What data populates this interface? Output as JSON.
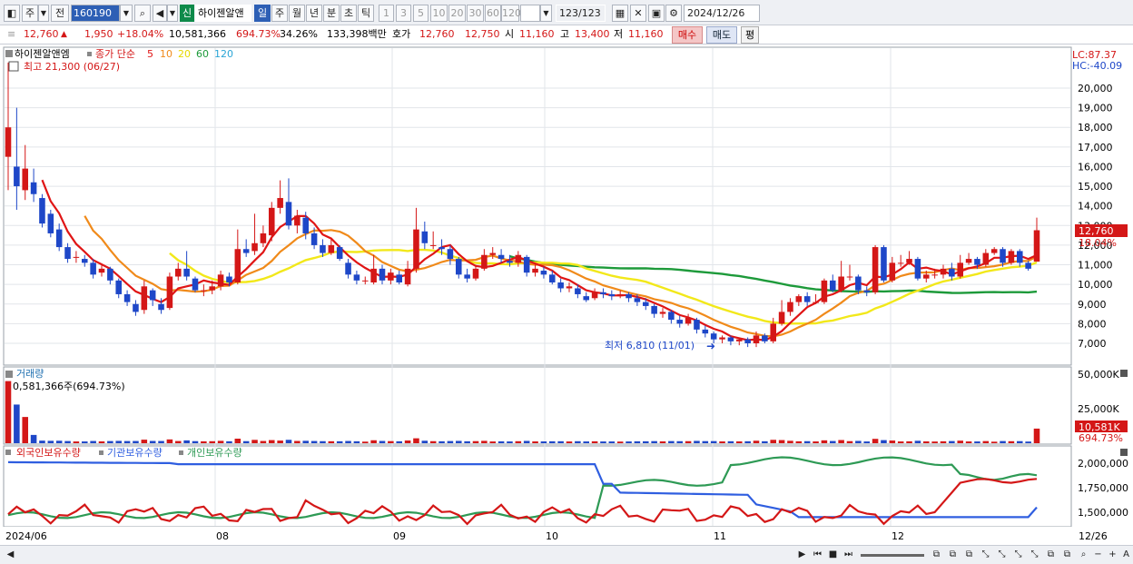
{
  "toolbar": {
    "market": "주",
    "scope": "전",
    "code": "160190",
    "flag": "신",
    "name": "하이젠알앤",
    "periods": [
      "일",
      "주",
      "월",
      "년",
      "분",
      "초",
      "틱"
    ],
    "selected_period": "일",
    "intervals": [
      "1",
      "3",
      "5",
      "10",
      "20",
      "30",
      "60",
      "120"
    ],
    "count": "123",
    "count_total": "/123",
    "date": "2024/12/26"
  },
  "quote": {
    "price": "12,760",
    "change": "1,950",
    "change_pct": "+18.04%",
    "volume": "10,581,366",
    "vol_ratio": "694.73%",
    "turnover": "34.26%",
    "amount": "133,398백만",
    "hoga_label": "호가",
    "ask": "12,760",
    "bid": "12,750",
    "open_label": "시",
    "open": "11,160",
    "high_label": "고",
    "high": "13,400",
    "low_label": "저",
    "low": "11,160",
    "buy": "매수",
    "sell": "매도",
    "avg": "평"
  },
  "price_panel": {
    "legend_name": "하이젠알앤엠",
    "legend_close": "종가 단순",
    "ma_periods": [
      "5",
      "10",
      "20",
      "60",
      "120"
    ],
    "high_note": "최고 21,300 (06/27)",
    "low_note": "최저 6,810 (11/01)",
    "lc": "LC:87.37",
    "hc": "HC:-40.09",
    "current_price": "12,760",
    "current_pct": "18.04%",
    "y_ticks": [
      "20,000",
      "19,000",
      "18,000",
      "17,000",
      "16,000",
      "15,000",
      "14,000",
      "13,000",
      "12,000",
      "11,000",
      "10,000",
      "9,000",
      "8,000",
      "7,000"
    ]
  },
  "volume_panel": {
    "title": "거래량",
    "info": "0,581,366주(694.73%)",
    "y_ticks": [
      "50,000K",
      "25,000K"
    ],
    "current_vol": "10,581K",
    "current_pct": "694.73%"
  },
  "holding_panel": {
    "legend": [
      "외국인보유수량",
      "기관보유수량",
      "개인보유수량"
    ],
    "y_ticks": [
      "2,000,000",
      "1,750,000",
      "1,500,000"
    ]
  },
  "x_labels": [
    "2024/06",
    "08",
    "09",
    "10",
    "11",
    "12"
  ],
  "x_end_label": "12/26",
  "colors": {
    "up": "#d41717",
    "down": "#1e47c8",
    "ma5": "#e01515",
    "ma10": "#f08a1a",
    "ma20": "#f2e81a",
    "ma60": "#1d9a3a",
    "ma120": "#2aa5d6",
    "foreign": "#d41717",
    "institution": "#2f5ee0",
    "individual": "#2e9a55"
  },
  "chart_data": {
    "type": "candlestick",
    "price_range": [
      6500,
      21300
    ],
    "candles": [
      {
        "o": 16500,
        "c": 18000,
        "h": 21300,
        "l": 14800
      },
      {
        "o": 16000,
        "c": 15000,
        "h": 19000,
        "l": 13800
      },
      {
        "o": 14800,
        "c": 15900,
        "h": 17100,
        "l": 14300
      },
      {
        "o": 15200,
        "c": 14600,
        "h": 15900,
        "l": 14200
      },
      {
        "o": 14400,
        "c": 13100,
        "h": 14600,
        "l": 12900
      },
      {
        "o": 13600,
        "c": 12600,
        "h": 13800,
        "l": 12400
      },
      {
        "o": 12800,
        "c": 11900,
        "h": 13100,
        "l": 11700
      },
      {
        "o": 11900,
        "c": 11300,
        "h": 12100,
        "l": 11100
      },
      {
        "o": 11400,
        "c": 11400,
        "h": 11700,
        "l": 11100
      },
      {
        "o": 11300,
        "c": 11100,
        "h": 11500,
        "l": 10900
      },
      {
        "o": 11100,
        "c": 10500,
        "h": 11300,
        "l": 10300
      },
      {
        "o": 10600,
        "c": 10800,
        "h": 11000,
        "l": 10400
      },
      {
        "o": 10800,
        "c": 10200,
        "h": 10900,
        "l": 10000
      },
      {
        "o": 10200,
        "c": 9500,
        "h": 10300,
        "l": 9300
      },
      {
        "o": 9500,
        "c": 9100,
        "h": 9700,
        "l": 8900
      },
      {
        "o": 9000,
        "c": 8600,
        "h": 9200,
        "l": 8400
      },
      {
        "o": 8700,
        "c": 9900,
        "h": 10200,
        "l": 8500
      },
      {
        "o": 9700,
        "c": 9200,
        "h": 9800,
        "l": 8900
      },
      {
        "o": 9000,
        "c": 8700,
        "h": 9300,
        "l": 8500
      },
      {
        "o": 8800,
        "c": 10400,
        "h": 10600,
        "l": 8700
      },
      {
        "o": 10400,
        "c": 10800,
        "h": 11100,
        "l": 10200
      },
      {
        "o": 10800,
        "c": 10400,
        "h": 11700,
        "l": 10200
      },
      {
        "o": 10300,
        "c": 9700,
        "h": 10400,
        "l": 9600
      },
      {
        "o": 9700,
        "c": 9700,
        "h": 10000,
        "l": 9400
      },
      {
        "o": 9700,
        "c": 9900,
        "h": 10200,
        "l": 9500
      },
      {
        "o": 9900,
        "c": 10500,
        "h": 10700,
        "l": 9700
      },
      {
        "o": 10400,
        "c": 10100,
        "h": 10600,
        "l": 9900
      },
      {
        "o": 10100,
        "c": 11800,
        "h": 12800,
        "l": 10000
      },
      {
        "o": 11800,
        "c": 11600,
        "h": 12300,
        "l": 11400
      },
      {
        "o": 11700,
        "c": 12100,
        "h": 13600,
        "l": 11500
      },
      {
        "o": 12100,
        "c": 12600,
        "h": 13000,
        "l": 11900
      },
      {
        "o": 12500,
        "c": 13900,
        "h": 14200,
        "l": 12200
      },
      {
        "o": 13900,
        "c": 14400,
        "h": 15300,
        "l": 13600
      },
      {
        "o": 14200,
        "c": 13000,
        "h": 15400,
        "l": 12800
      },
      {
        "o": 13000,
        "c": 13500,
        "h": 13800,
        "l": 12600
      },
      {
        "o": 13400,
        "c": 12600,
        "h": 13700,
        "l": 12300
      },
      {
        "o": 12600,
        "c": 12000,
        "h": 12900,
        "l": 11800
      },
      {
        "o": 12000,
        "c": 11600,
        "h": 12300,
        "l": 11400
      },
      {
        "o": 11600,
        "c": 12000,
        "h": 12300,
        "l": 11500
      },
      {
        "o": 11900,
        "c": 11300,
        "h": 12000,
        "l": 11200
      },
      {
        "o": 11100,
        "c": 10500,
        "h": 11300,
        "l": 10300
      },
      {
        "o": 10500,
        "c": 10200,
        "h": 10700,
        "l": 10000
      },
      {
        "o": 10200,
        "c": 10200,
        "h": 10400,
        "l": 10000
      },
      {
        "o": 10100,
        "c": 10800,
        "h": 11500,
        "l": 10000
      },
      {
        "o": 10800,
        "c": 10200,
        "h": 11000,
        "l": 10000
      },
      {
        "o": 10200,
        "c": 10600,
        "h": 10800,
        "l": 10000
      },
      {
        "o": 10500,
        "c": 10100,
        "h": 10700,
        "l": 10000
      },
      {
        "o": 10000,
        "c": 10800,
        "h": 11200,
        "l": 9900
      },
      {
        "o": 10800,
        "c": 12800,
        "h": 13900,
        "l": 10600
      },
      {
        "o": 12700,
        "c": 12100,
        "h": 13200,
        "l": 11800
      },
      {
        "o": 12000,
        "c": 12000,
        "h": 12700,
        "l": 11800
      },
      {
        "o": 11900,
        "c": 11800,
        "h": 12300,
        "l": 11500
      },
      {
        "o": 11800,
        "c": 11300,
        "h": 12000,
        "l": 11000
      },
      {
        "o": 11300,
        "c": 10500,
        "h": 11400,
        "l": 10300
      },
      {
        "o": 10500,
        "c": 10300,
        "h": 10800,
        "l": 10100
      },
      {
        "o": 10300,
        "c": 10800,
        "h": 11000,
        "l": 10200
      },
      {
        "o": 10800,
        "c": 11500,
        "h": 11800,
        "l": 10700
      },
      {
        "o": 11500,
        "c": 11600,
        "h": 11900,
        "l": 11300
      },
      {
        "o": 11500,
        "c": 11300,
        "h": 11800,
        "l": 11100
      },
      {
        "o": 11200,
        "c": 11100,
        "h": 11500,
        "l": 10900
      },
      {
        "o": 11100,
        "c": 11500,
        "h": 11700,
        "l": 10900
      },
      {
        "o": 11400,
        "c": 10600,
        "h": 11500,
        "l": 10400
      },
      {
        "o": 10600,
        "c": 10800,
        "h": 11000,
        "l": 10400
      },
      {
        "o": 10700,
        "c": 10500,
        "h": 10900,
        "l": 10300
      },
      {
        "o": 10500,
        "c": 10100,
        "h": 10700,
        "l": 10000
      },
      {
        "o": 10100,
        "c": 9800,
        "h": 10300,
        "l": 9600
      },
      {
        "o": 9800,
        "c": 9900,
        "h": 10100,
        "l": 9600
      },
      {
        "o": 9800,
        "c": 9500,
        "h": 10000,
        "l": 9300
      },
      {
        "o": 9400,
        "c": 9200,
        "h": 9600,
        "l": 9100
      },
      {
        "o": 9300,
        "c": 9600,
        "h": 9800,
        "l": 9200
      },
      {
        "o": 9600,
        "c": 9500,
        "h": 9800,
        "l": 9300
      },
      {
        "o": 9500,
        "c": 9400,
        "h": 9700,
        "l": 9200
      },
      {
        "o": 9400,
        "c": 9500,
        "h": 9700,
        "l": 9300
      },
      {
        "o": 9500,
        "c": 9300,
        "h": 9600,
        "l": 9100
      },
      {
        "o": 9300,
        "c": 9100,
        "h": 9500,
        "l": 8900
      },
      {
        "o": 9100,
        "c": 8900,
        "h": 9300,
        "l": 8700
      },
      {
        "o": 8900,
        "c": 8500,
        "h": 9000,
        "l": 8300
      },
      {
        "o": 8500,
        "c": 8600,
        "h": 8800,
        "l": 8300
      },
      {
        "o": 8600,
        "c": 8200,
        "h": 8700,
        "l": 8000
      },
      {
        "o": 8200,
        "c": 8000,
        "h": 8400,
        "l": 7800
      },
      {
        "o": 8000,
        "c": 8300,
        "h": 8500,
        "l": 7900
      },
      {
        "o": 8200,
        "c": 7700,
        "h": 8300,
        "l": 7500
      },
      {
        "o": 7700,
        "c": 7500,
        "h": 7900,
        "l": 7300
      },
      {
        "o": 7500,
        "c": 7200,
        "h": 7600,
        "l": 7000
      },
      {
        "o": 7200,
        "c": 7300,
        "h": 7400,
        "l": 7000
      },
      {
        "o": 7300,
        "c": 7100,
        "h": 7400,
        "l": 6900
      },
      {
        "o": 7100,
        "c": 7200,
        "h": 7300,
        "l": 6900
      },
      {
        "o": 7200,
        "c": 7000,
        "h": 7300,
        "l": 6810
      },
      {
        "o": 7000,
        "c": 7400,
        "h": 7600,
        "l": 6810
      },
      {
        "o": 7400,
        "c": 7100,
        "h": 7500,
        "l": 7000
      },
      {
        "o": 7100,
        "c": 8000,
        "h": 8300,
        "l": 7000
      },
      {
        "o": 8000,
        "c": 8600,
        "h": 9200,
        "l": 7900
      },
      {
        "o": 8600,
        "c": 9100,
        "h": 9300,
        "l": 8400
      },
      {
        "o": 9100,
        "c": 9400,
        "h": 9500,
        "l": 8900
      },
      {
        "o": 9400,
        "c": 9100,
        "h": 9600,
        "l": 8900
      },
      {
        "o": 9100,
        "c": 9100,
        "h": 9500,
        "l": 9000
      },
      {
        "o": 9100,
        "c": 10200,
        "h": 10300,
        "l": 9000
      },
      {
        "o": 10200,
        "c": 9700,
        "h": 10500,
        "l": 9600
      },
      {
        "o": 9700,
        "c": 10400,
        "h": 11200,
        "l": 9600
      },
      {
        "o": 10400,
        "c": 10400,
        "h": 11000,
        "l": 10200
      },
      {
        "o": 10400,
        "c": 9700,
        "h": 10500,
        "l": 9500
      },
      {
        "o": 9700,
        "c": 9600,
        "h": 9900,
        "l": 9400
      },
      {
        "o": 9600,
        "c": 11900,
        "h": 12000,
        "l": 9500
      },
      {
        "o": 11900,
        "c": 10200,
        "h": 12000,
        "l": 10100
      },
      {
        "o": 10200,
        "c": 11100,
        "h": 11400,
        "l": 10100
      },
      {
        "o": 11100,
        "c": 11100,
        "h": 11500,
        "l": 10900
      },
      {
        "o": 11100,
        "c": 11300,
        "h": 11700,
        "l": 11000
      },
      {
        "o": 11300,
        "c": 10300,
        "h": 11400,
        "l": 10200
      },
      {
        "o": 10300,
        "c": 10500,
        "h": 10700,
        "l": 10100
      },
      {
        "o": 10500,
        "c": 10500,
        "h": 10800,
        "l": 10300
      },
      {
        "o": 10500,
        "c": 10800,
        "h": 11000,
        "l": 10300
      },
      {
        "o": 10800,
        "c": 10400,
        "h": 11100,
        "l": 10200
      },
      {
        "o": 10400,
        "c": 11100,
        "h": 11500,
        "l": 10300
      },
      {
        "o": 11100,
        "c": 11300,
        "h": 11600,
        "l": 11000
      },
      {
        "o": 11300,
        "c": 11000,
        "h": 11400,
        "l": 10800
      },
      {
        "o": 11000,
        "c": 11600,
        "h": 11800,
        "l": 10900
      },
      {
        "o": 11600,
        "c": 11800,
        "h": 11900,
        "l": 11500
      },
      {
        "o": 11800,
        "c": 11100,
        "h": 11900,
        "l": 10900
      },
      {
        "o": 11100,
        "c": 11700,
        "h": 11800,
        "l": 11000
      },
      {
        "o": 11700,
        "c": 11100,
        "h": 11800,
        "l": 10900
      },
      {
        "o": 11100,
        "c": 10800,
        "h": 11200,
        "l": 10700
      },
      {
        "o": 11160,
        "c": 12760,
        "h": 13400,
        "l": 11160
      }
    ]
  }
}
